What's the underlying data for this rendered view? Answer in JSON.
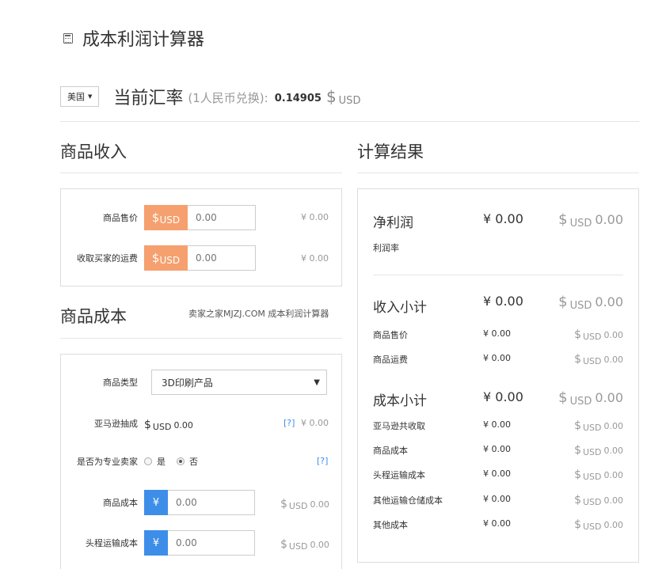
{
  "page": {
    "title": "成本利润计算器",
    "icon": "calculator-icon"
  },
  "exchange": {
    "country": "美国",
    "title": "当前汇率",
    "subtitle": "(1人民币兑换):",
    "rate": "0.14905",
    "currency_symbol": "$",
    "currency_unit": "USD"
  },
  "income": {
    "title": "商品收入",
    "rows": [
      {
        "label": "商品售价",
        "addon_symbol": "$",
        "addon_unit": "USD",
        "placeholder": "0.00",
        "cny": "¥ 0.00"
      },
      {
        "label": "收取买家的运费",
        "addon_symbol": "$",
        "addon_unit": "USD",
        "placeholder": "0.00",
        "cny": "¥ 0.00"
      }
    ]
  },
  "cost": {
    "title": "商品成本",
    "note": "卖家之家MJZJ.COM 成本利润计算器",
    "type_label": "商品类型",
    "type_value": "3D印刷产品",
    "commission_label": "亚马逊抽成",
    "commission_symbol": "$",
    "commission_unit": "USD",
    "commission_value": "0.00",
    "commission_help": "[?]",
    "commission_cny": "¥ 0.00",
    "pro_label": "是否为专业卖家",
    "pro_yes": "是",
    "pro_no": "否",
    "pro_help": "[?]",
    "rows": [
      {
        "label": "商品成本",
        "addon": "¥",
        "placeholder": "0.00",
        "usd_symbol": "$",
        "usd_unit": "USD",
        "usd_value": "0.00"
      },
      {
        "label": "头程运输成本",
        "addon": "¥",
        "placeholder": "0.00",
        "usd_symbol": "$",
        "usd_unit": "USD",
        "usd_value": "0.00"
      }
    ]
  },
  "result": {
    "title": "计算结果",
    "net_profit": {
      "label": "净利润",
      "cny": "¥ 0.00",
      "usd_symbol": "$",
      "usd_unit": "USD",
      "usd_value": "0.00"
    },
    "margin_label": "利润率",
    "income_subtotal": {
      "label": "收入小计",
      "cny": "¥ 0.00",
      "usd_symbol": "$",
      "usd_unit": "USD",
      "usd_value": "0.00"
    },
    "income_rows": [
      {
        "label": "商品售价",
        "cny": "¥ 0.00",
        "usd_symbol": "$",
        "usd_unit": "USD",
        "usd_value": "0.00"
      },
      {
        "label": "商品运费",
        "cny": "¥ 0.00",
        "usd_symbol": "$",
        "usd_unit": "USD",
        "usd_value": "0.00"
      }
    ],
    "cost_subtotal": {
      "label": "成本小计",
      "cny": "¥ 0.00",
      "usd_symbol": "$",
      "usd_unit": "USD",
      "usd_value": "0.00"
    },
    "cost_rows": [
      {
        "label": "亚马逊共收取",
        "cny": "¥ 0.00",
        "usd_symbol": "$",
        "usd_unit": "USD",
        "usd_value": "0.00"
      },
      {
        "label": "商品成本",
        "cny": "¥ 0.00",
        "usd_symbol": "$",
        "usd_unit": "USD",
        "usd_value": "0.00"
      },
      {
        "label": "头程运输成本",
        "cny": "¥ 0.00",
        "usd_symbol": "$",
        "usd_unit": "USD",
        "usd_value": "0.00"
      },
      {
        "label": "其他运输仓储成本",
        "cny": "¥ 0.00",
        "usd_symbol": "$",
        "usd_unit": "USD",
        "usd_value": "0.00"
      },
      {
        "label": "其他成本",
        "cny": "¥ 0.00",
        "usd_symbol": "$",
        "usd_unit": "USD",
        "usd_value": "0.00"
      }
    ]
  },
  "colors": {
    "usd_addon": "#f5a06e",
    "cny_addon": "#3d8ee8",
    "help_link": "#3d8ee8"
  }
}
